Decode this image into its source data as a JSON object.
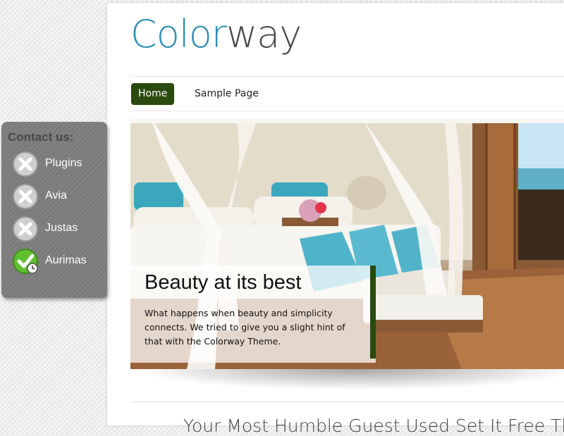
{
  "site": {
    "logo_part1": "Color",
    "logo_part2": "way",
    "accent_color": "#2f8fb4",
    "nav_active_color": "#2a4a0e"
  },
  "nav": {
    "items": [
      {
        "label": "Home",
        "active": true
      },
      {
        "label": "Sample Page",
        "active": false
      }
    ]
  },
  "slider": {
    "caption_title": "Beauty at its best",
    "caption_text": "What happens when beauty and simplicity connects. We tried to give you a slight hint of that with the Colorway Theme."
  },
  "post": {
    "title_partial": "Your Most Humble Guest Used Set It Free The"
  },
  "contact": {
    "title": "Contact us:",
    "items": [
      {
        "label": "Plugins",
        "status": "offline",
        "icon": "offline-x-icon"
      },
      {
        "label": "Avia",
        "status": "offline",
        "icon": "offline-x-icon"
      },
      {
        "label": "Justas",
        "status": "offline",
        "icon": "offline-x-icon"
      },
      {
        "label": "Aurimas",
        "status": "online",
        "icon": "online-check-icon"
      }
    ]
  }
}
